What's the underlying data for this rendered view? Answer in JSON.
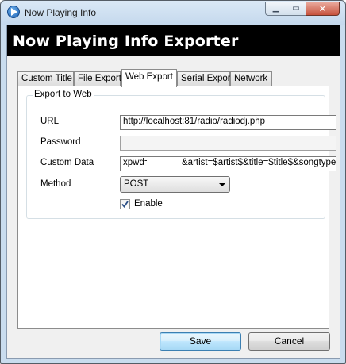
{
  "window": {
    "title": "Now Playing Info",
    "controls": {
      "minimize": "▁",
      "maximize": "▭",
      "close": "✕"
    }
  },
  "header": {
    "title": "Now Playing Info Exporter"
  },
  "tabs": [
    {
      "label": "Custom Title",
      "active": false
    },
    {
      "label": "File Export",
      "active": false
    },
    {
      "label": "Web Export",
      "active": true
    },
    {
      "label": "Serial Export",
      "active": false
    },
    {
      "label": "Network",
      "active": false
    }
  ],
  "web_export": {
    "group_title": "Export to Web",
    "url": {
      "label": "URL",
      "value": "http://localhost:81/radio/radiodj.php"
    },
    "password": {
      "label": "Password",
      "value": ""
    },
    "custom_data": {
      "label": "Custom Data",
      "value_start": "xpwd=",
      "value_end": "&artist=$artist$&title=$title$&songtype=$tra"
    },
    "method": {
      "label": "Method",
      "selected": "POST"
    },
    "enable": {
      "label": "Enable",
      "checked": true
    }
  },
  "buttons": {
    "save": "Save",
    "cancel": "Cancel"
  },
  "colors": {
    "header_bg": "#000000",
    "header_text": "#ffffff",
    "frame": "#c9dcee"
  }
}
